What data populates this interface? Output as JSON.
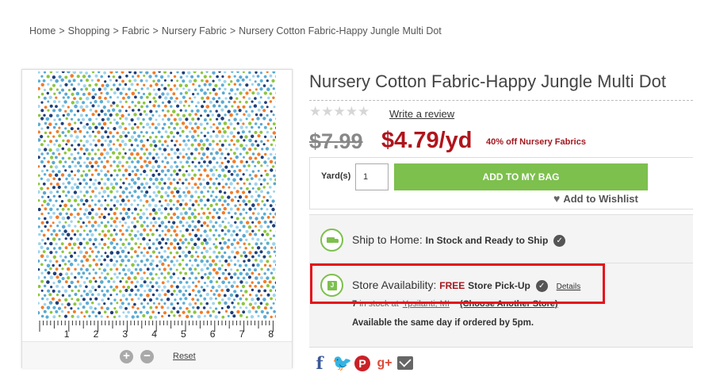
{
  "breadcrumb": {
    "items": [
      "Home",
      "Shopping",
      "Fabric",
      "Nursery Fabric",
      "Nursery Cotton Fabric-Happy Jungle Multi Dot"
    ],
    "separator": ">"
  },
  "product": {
    "title": "Nursery Cotton Fabric-Happy Jungle Multi Dot",
    "rating_stars": "★★★★★",
    "review_link": "Write a review",
    "price_was": "$7.99",
    "price_now": "$4.79/yd",
    "promo": "40% off Nursery Fabrics"
  },
  "image_viewer": {
    "ruler_numbers": [
      "1",
      "2",
      "3",
      "4",
      "5",
      "6",
      "7",
      "8"
    ],
    "zoom_in": "+",
    "zoom_out": "−",
    "reset": "Reset",
    "dot_colors": [
      "#5aaed6",
      "#9fd4ec",
      "#1f3f7a",
      "#f07d2a",
      "#8cc63f",
      "#5ba8cf"
    ]
  },
  "cart": {
    "qty_label": "Yard(s)",
    "qty_value": "1",
    "add_button": "ADD TO MY BAG",
    "wishlist": "Add to Wishlist"
  },
  "availability": {
    "ship_label": "Ship to Home:",
    "ship_status": "In Stock and Ready to Ship",
    "store_label": "Store Availability:",
    "store_free": "FREE",
    "store_pickup": "Store Pick-Up",
    "details_link": "Details",
    "stock_count": "7",
    "stock_text": "in stock at",
    "store_location": "Ypsilanti, MI",
    "change_store": "(Choose Another Store)",
    "same_day": "Available the same day if ordered by 5pm."
  },
  "share": {
    "icons": [
      "facebook-icon",
      "twitter-icon",
      "pinterest-icon",
      "google-plus-icon",
      "email-icon"
    ]
  },
  "colors": {
    "sale_red": "#b0141c",
    "button_green": "#7dc04d",
    "highlight_red": "#e3141c"
  }
}
